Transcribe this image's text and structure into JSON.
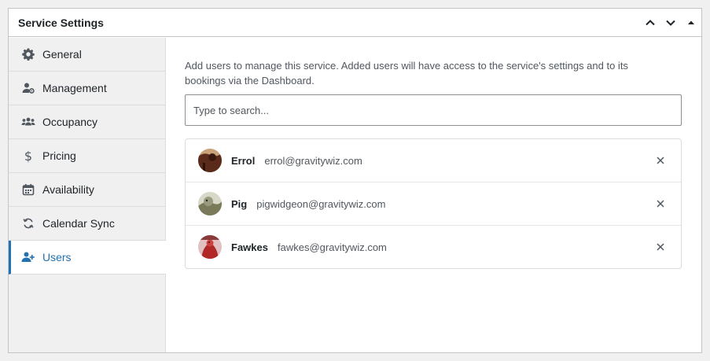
{
  "panel": {
    "title": "Service Settings",
    "actions": [
      {
        "icon": "chevron-up-icon"
      },
      {
        "icon": "chevron-down-icon"
      },
      {
        "icon": "triangle-up-icon"
      }
    ]
  },
  "sidebar": {
    "items": [
      {
        "label": "General",
        "icon": "gear-icon"
      },
      {
        "label": "Management",
        "icon": "user-gear-icon"
      },
      {
        "label": "Occupancy",
        "icon": "users-group-icon"
      },
      {
        "label": "Pricing",
        "icon": "dollar-icon"
      },
      {
        "label": "Availability",
        "icon": "calendar-icon"
      },
      {
        "label": "Calendar Sync",
        "icon": "sync-icon"
      },
      {
        "label": "Users",
        "icon": "user-plus-icon",
        "active": true
      }
    ]
  },
  "main": {
    "description": "Add users to manage this service. Added users will have access to the service's settings and to its bookings via the Dashboard.",
    "search_placeholder": "Type to search...",
    "users": [
      {
        "name": "Errol",
        "email": "errol@gravitywiz.com",
        "avatar_colors": [
          "#5a2a1a",
          "#c9a27a"
        ]
      },
      {
        "name": "Pig",
        "email": "pigwidgeon@gravitywiz.com",
        "avatar_colors": [
          "#7a7a5a",
          "#d8d8c8"
        ]
      },
      {
        "name": "Fawkes",
        "email": "fawkes@gravitywiz.com",
        "avatar_colors": [
          "#b02828",
          "#e0c0c0"
        ]
      }
    ]
  },
  "colors": {
    "accent": "#2271b1",
    "sidebar_bg": "#f0f0f1"
  }
}
